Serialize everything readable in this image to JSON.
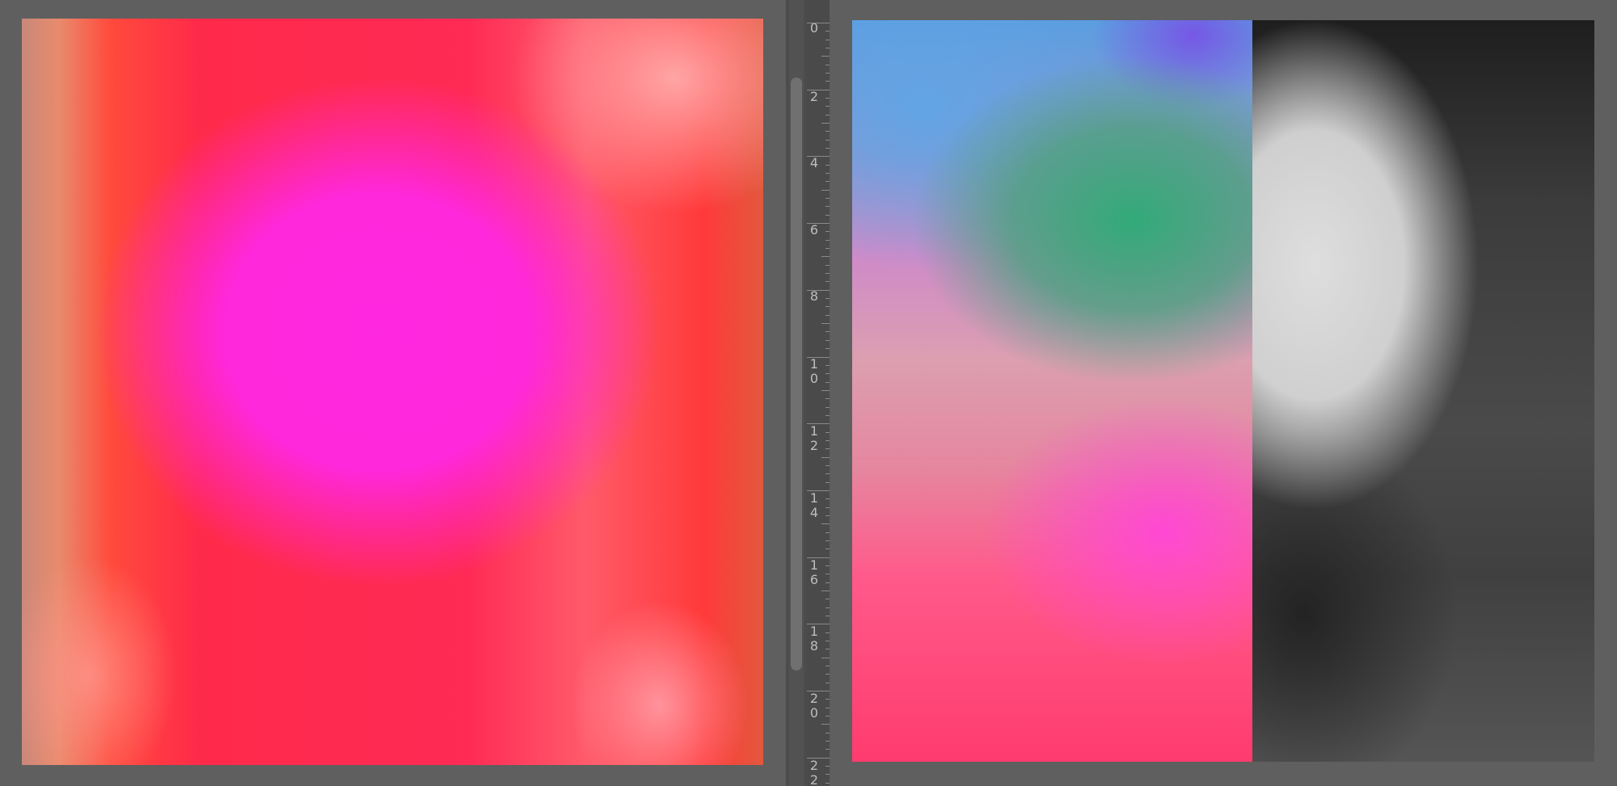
{
  "ruler": {
    "labels": [
      {
        "text": "0"
      },
      {
        "text": "2"
      },
      {
        "text": "4"
      },
      {
        "text": "6"
      },
      {
        "text": "8"
      },
      {
        "text": "1\n0"
      },
      {
        "text": "1\n2"
      },
      {
        "text": "1\n4"
      },
      {
        "text": "1\n6"
      },
      {
        "text": "1\n8"
      },
      {
        "text": "2\n0"
      },
      {
        "text": "2\n2"
      }
    ]
  },
  "colors": {
    "background": "#5f5f5f",
    "ruler_bg": "#4a4a4a",
    "ruler_text": "#bdbdbd"
  }
}
